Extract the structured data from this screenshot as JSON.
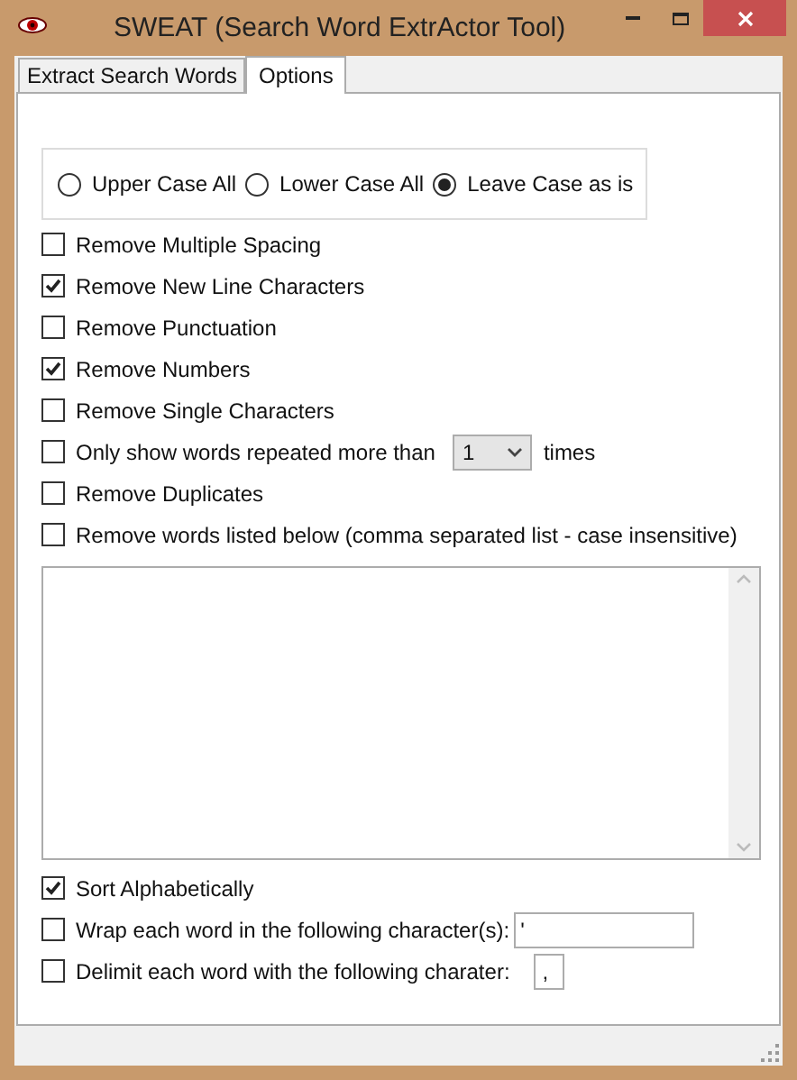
{
  "window": {
    "title": "SWEAT (Search Word ExtrActor Tool)"
  },
  "tabs": [
    {
      "label": "Extract Search Words",
      "selected": false
    },
    {
      "label": "Options",
      "selected": true
    }
  ],
  "case_options": [
    {
      "label": "Upper Case All",
      "selected": false
    },
    {
      "label": "Lower Case All",
      "selected": false
    },
    {
      "label": "Leave Case as is",
      "selected": true
    }
  ],
  "options": [
    {
      "kind": "plain",
      "label": "Remove Multiple Spacing",
      "checked": false
    },
    {
      "kind": "plain",
      "label": "Remove New Line Characters",
      "checked": true
    },
    {
      "kind": "plain",
      "label": "Remove Punctuation",
      "checked": false
    },
    {
      "kind": "plain",
      "label": "Remove Numbers",
      "checked": true
    },
    {
      "kind": "plain",
      "label": "Remove Single Characters",
      "checked": false
    },
    {
      "kind": "dropdown",
      "label": "Only show words repeated more than",
      "checked": false,
      "value": "1",
      "suffix": "times"
    },
    {
      "kind": "plain",
      "label": "Remove Duplicates",
      "checked": false
    },
    {
      "kind": "plain",
      "label": "Remove words listed below (comma separated list - case insensitive)",
      "checked": false
    }
  ],
  "output_options": [
    {
      "kind": "plain",
      "label": "Sort Alphabetically",
      "checked": true
    },
    {
      "kind": "wide_field",
      "label": "Wrap each word in the following character(s):",
      "checked": false,
      "value": "'"
    },
    {
      "kind": "small_field",
      "label": "Delimit each word with the following charater:",
      "checked": false,
      "value": ","
    }
  ]
}
